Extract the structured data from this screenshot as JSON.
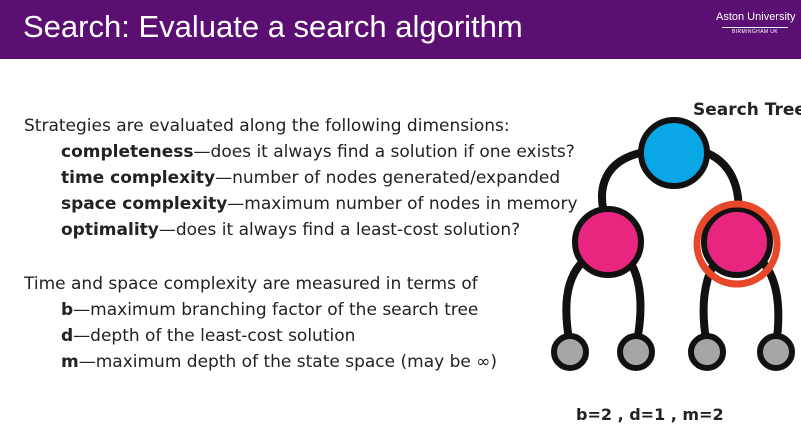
{
  "header": {
    "title": "Search: Evaluate a search algorithm",
    "logo": {
      "name": "Aston University",
      "sub": "BIRMINGHAM UK"
    }
  },
  "dimensions": {
    "intro": "Strategies are evaluated along the following dimensions:",
    "items": [
      {
        "term": "completeness",
        "desc": "—does it always find a solution if one exists?"
      },
      {
        "term": "time complexity",
        "desc": "—number of nodes generated/expanded"
      },
      {
        "term": "space complexity",
        "desc": "—maximum number of nodes in memory"
      },
      {
        "term": "optimality",
        "desc": "—does it always find a least-cost solution?"
      }
    ]
  },
  "measures": {
    "intro": "Time and space complexity are measured in terms of",
    "items": [
      {
        "term": "b",
        "desc": "—maximum branching factor of the search tree"
      },
      {
        "term": "d",
        "desc": "—depth of the least-cost solution"
      },
      {
        "term": "m",
        "desc": "—maximum depth of the state space (may be ∞)"
      }
    ]
  },
  "tree": {
    "label": "Search Tree",
    "params": "b=2 ,  d=1 ,  m=2",
    "colors": {
      "root": "#0aa7e6",
      "level1": "#e8267f",
      "leaf": "#a6a6a6",
      "edge": "#111111",
      "highlight": "#e8482a"
    }
  }
}
